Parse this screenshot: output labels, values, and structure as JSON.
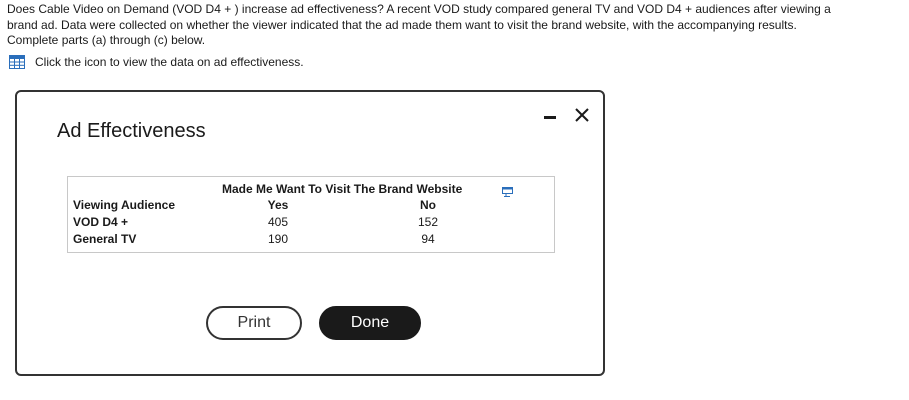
{
  "question": {
    "line1": "Does Cable Video on Demand (VOD D4 + ) increase ad effectiveness? A recent VOD study compared general TV and VOD D4 +  audiences after viewing a",
    "line2": "brand ad. Data were collected on whether the viewer indicated that the ad made them want to visit the brand website, with the accompanying results.",
    "line3": "Complete parts (a) through (c) below."
  },
  "data_link": {
    "label": "Click the icon to view the data on ad effectiveness.",
    "icon": "table-grid-icon"
  },
  "modal": {
    "title": "Ad Effectiveness",
    "minimize_icon": "minimize-icon",
    "close_icon": "close-icon",
    "table": {
      "group_header": "Made Me Want To Visit The Brand Website",
      "row_header": "Viewing Audience",
      "columns": [
        "Yes",
        "No"
      ],
      "rows": [
        {
          "label": "VOD D4 +",
          "values": [
            "405",
            "152"
          ]
        },
        {
          "label": "General TV",
          "values": [
            "190",
            "94"
          ]
        }
      ],
      "copy_icon": "copy-data-icon"
    },
    "buttons": {
      "print": "Print",
      "done": "Done"
    }
  },
  "colors": {
    "text": "#1a1a1a",
    "border": "#333333",
    "done_bg": "#1a1a1a",
    "link_icon": "#2a6ebb"
  }
}
